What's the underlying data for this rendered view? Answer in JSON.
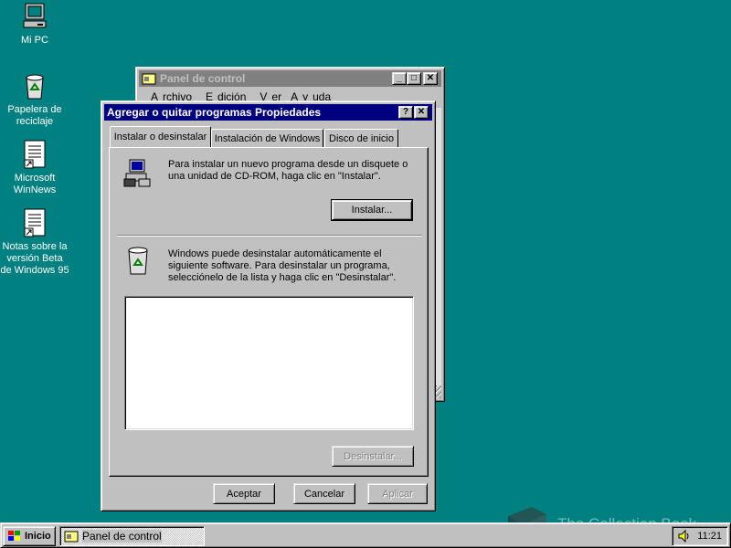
{
  "desktop": {
    "icons": [
      {
        "label": "Mi PC",
        "icon": "my-computer-icon"
      },
      {
        "label": "Papelera de reciclaje",
        "icon": "recycle-bin-icon"
      },
      {
        "label": "Microsoft WinNews",
        "icon": "document-shortcut-icon"
      },
      {
        "label": "Notas sobre la versión Beta de Windows 95",
        "icon": "document-shortcut-icon"
      }
    ]
  },
  "control_panel": {
    "title": "Panel de control",
    "menu": [
      "Archivo",
      "Edición",
      "Ver",
      "Ayuda"
    ]
  },
  "dialog": {
    "title": "Agregar o quitar programas Propiedades",
    "tabs": [
      "Instalar o desinstalar",
      "Instalación de Windows",
      "Disco de inicio"
    ],
    "install_text": "Para instalar un nuevo programa desde un disquete o una unidad de CD-ROM, haga clic en \"Instalar\".",
    "install_button": "Instalar...",
    "uninstall_text": "Windows puede desinstalar automáticamente el siguiente software. Para desinstalar un programa, selecciónelo de la lista y haga clic en \"Desinstalar\".",
    "uninstall_button": "Desinstalar...",
    "ok_button": "Aceptar",
    "cancel_button": "Cancelar",
    "apply_button": "Aplicar"
  },
  "taskbar": {
    "start_label": "Inicio",
    "task_label": "Panel de control",
    "clock": "11:21"
  },
  "watermark": "The Collection Book",
  "colors": {
    "desktop": "#008080",
    "active_title": "#000080",
    "inactive_title": "#808080",
    "face": "#c0c0c0"
  }
}
